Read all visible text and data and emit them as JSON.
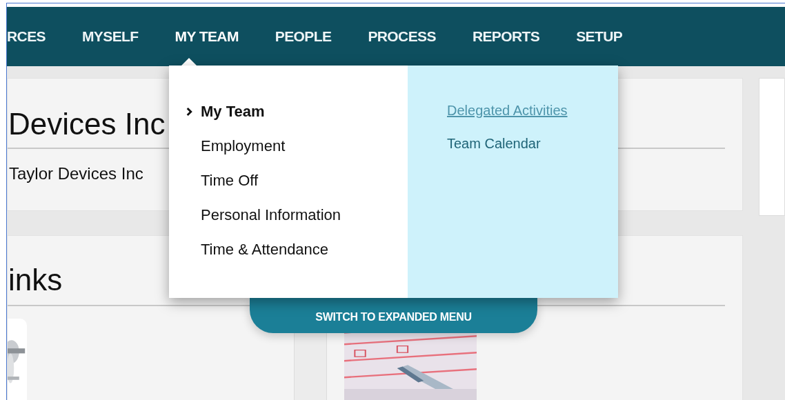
{
  "nav": {
    "items": [
      {
        "label": "RCES",
        "selected": false
      },
      {
        "label": "MYSELF",
        "selected": false
      },
      {
        "label": "MY TEAM",
        "selected": true
      },
      {
        "label": "PEOPLE",
        "selected": false
      },
      {
        "label": "PROCESS",
        "selected": false
      },
      {
        "label": "REPORTS",
        "selected": false
      },
      {
        "label": "SETUP",
        "selected": false
      }
    ]
  },
  "cards": [
    {
      "title": "Devices Inc",
      "subtitle": "Taylor Devices Inc"
    },
    {
      "title": "inks"
    }
  ],
  "menu": {
    "primary": [
      {
        "label": "My Team",
        "selected": true
      },
      {
        "label": "Employment",
        "selected": false
      },
      {
        "label": "Time Off",
        "selected": false
      },
      {
        "label": "Personal Information",
        "selected": false
      },
      {
        "label": "Time & Attendance",
        "selected": false
      }
    ],
    "secondary": [
      {
        "label": "Delegated Activities",
        "hovered": true
      },
      {
        "label": "Team Calendar",
        "hovered": false
      }
    ]
  },
  "switch_button": {
    "label": "SWITCH TO EXPANDED MENU"
  }
}
